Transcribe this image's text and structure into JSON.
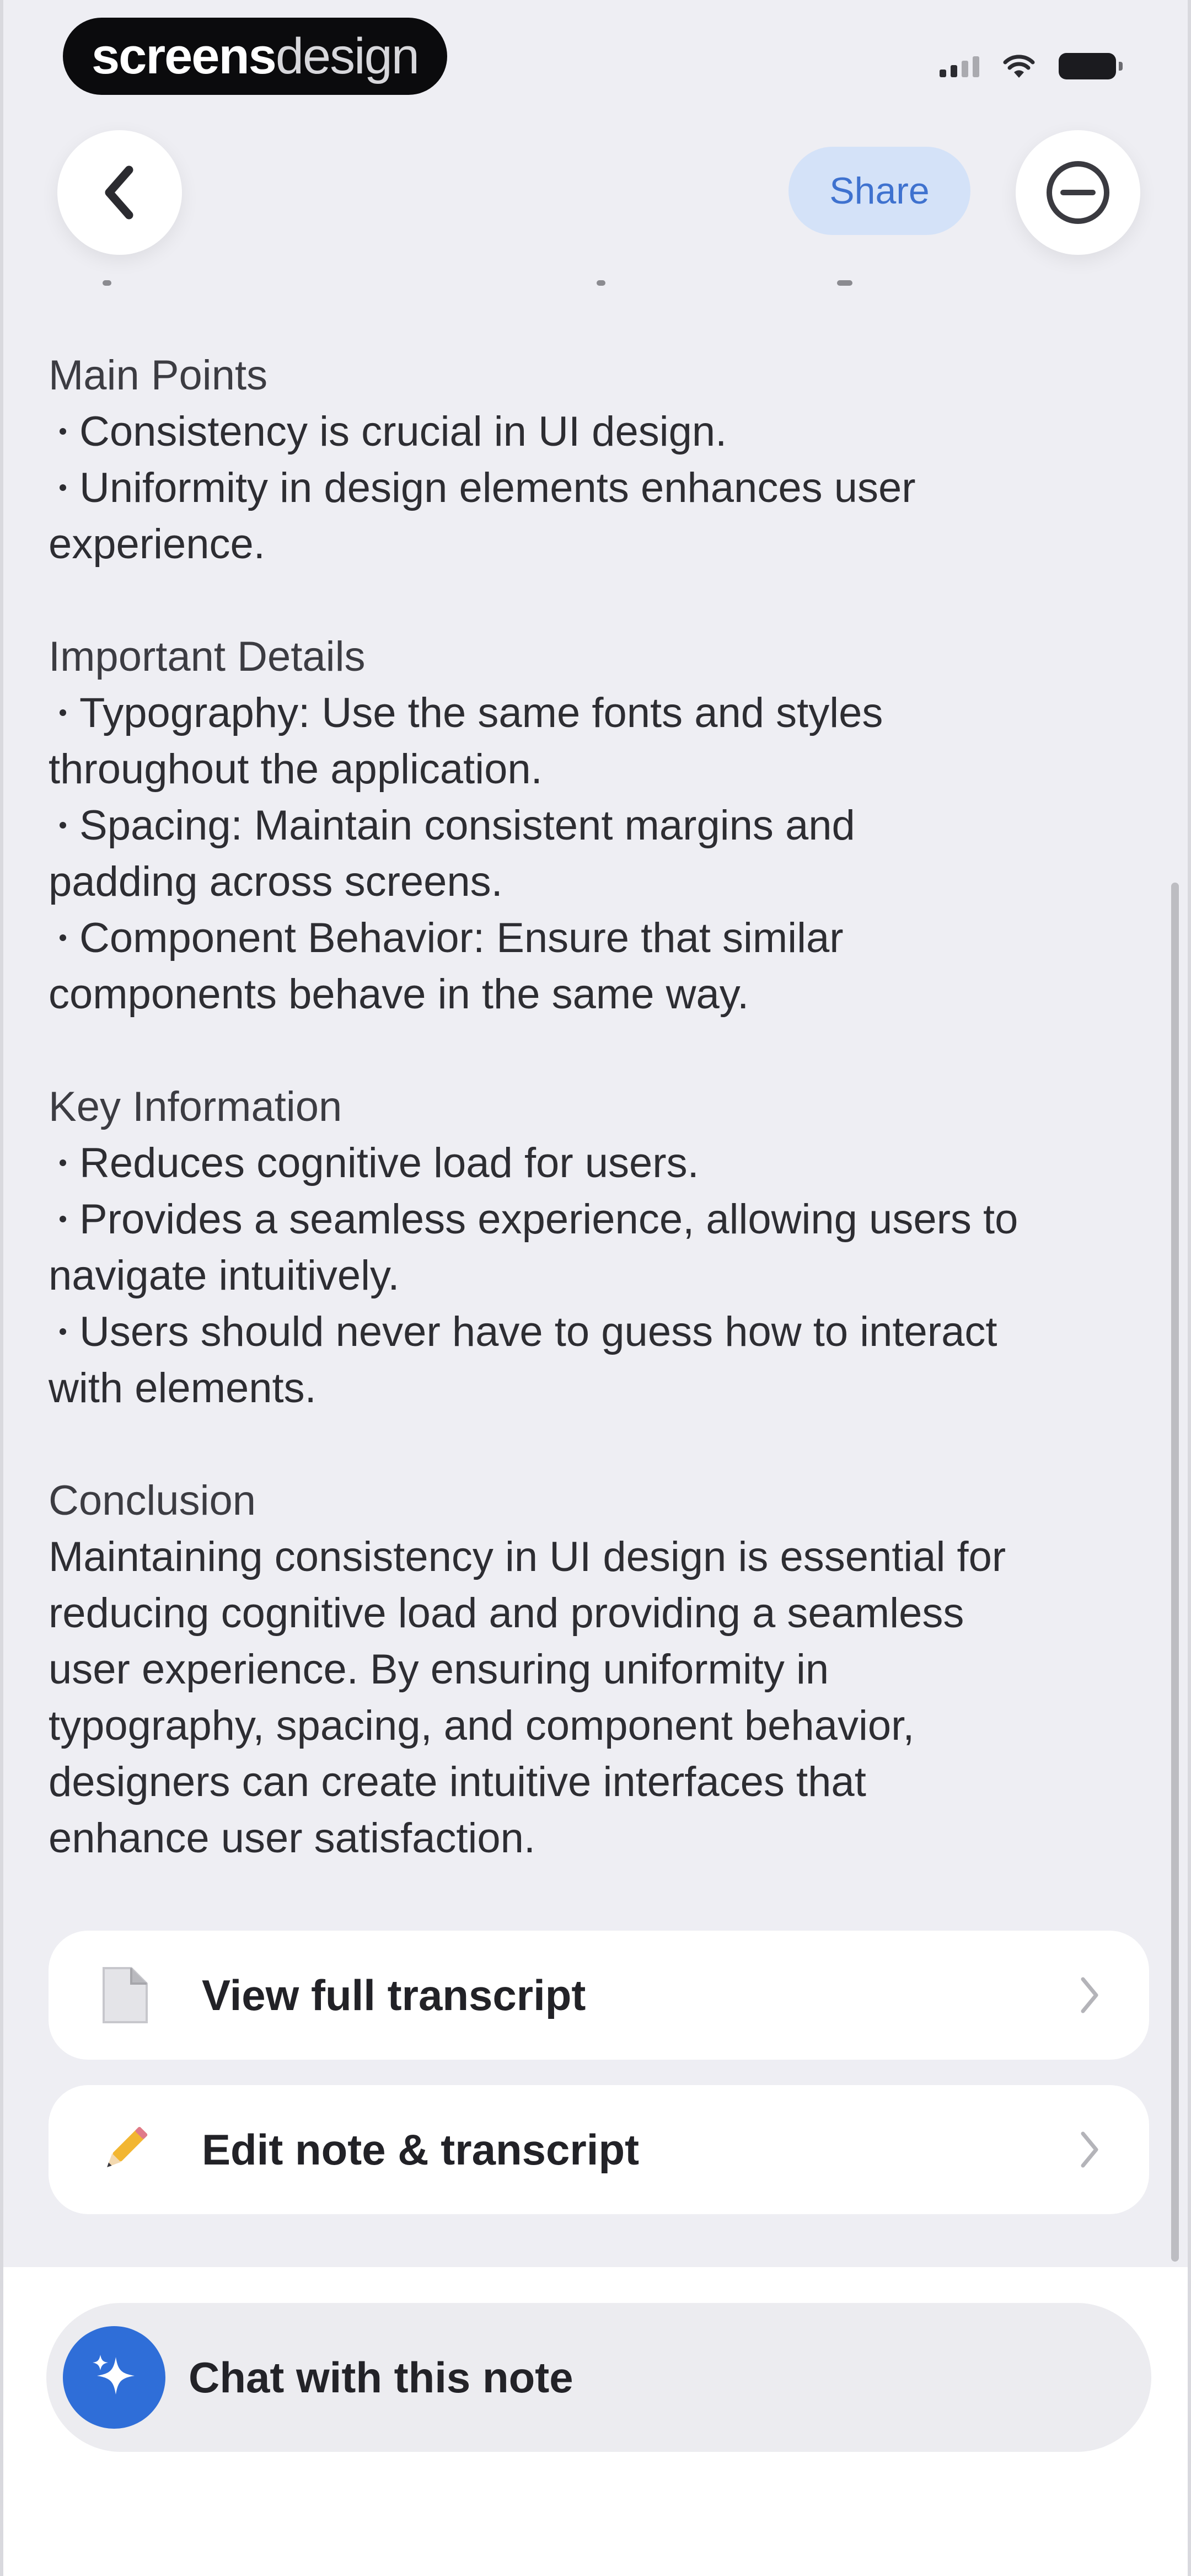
{
  "status_bar": {
    "brand_bold": "screens",
    "brand_light": "design"
  },
  "header": {
    "share_label": "Share",
    "back_icon": "chevron-left-icon",
    "more_icon": "minus-circle-icon"
  },
  "note": {
    "main_points": {
      "title": "Main Points",
      "bullets": [
        [
          "Consistency is crucial in UI design."
        ],
        [
          "Uniformity in design elements enhances user",
          "experience."
        ]
      ]
    },
    "important_details": {
      "title": "Important Details",
      "bullets": [
        [
          "Typography: Use the same fonts and styles",
          "throughout the application."
        ],
        [
          "Spacing: Maintain consistent margins and",
          "padding across screens."
        ],
        [
          "Component Behavior: Ensure that similar",
          "components behave in the same way."
        ]
      ]
    },
    "key_information": {
      "title": "Key Information",
      "bullets": [
        [
          "Reduces cognitive load for users."
        ],
        [
          "Provides a seamless experience, allowing users to",
          "navigate intuitively."
        ],
        [
          "Users should never have to guess how to interact",
          "with elements."
        ]
      ]
    },
    "conclusion": {
      "title": "Conclusion",
      "lines": [
        "Maintaining consistency in UI design is essential for",
        "reducing cognitive load and providing a seamless",
        "user experience. By ensuring uniformity in",
        "typography, spacing, and component behavior,",
        "designers can create intuitive interfaces that",
        "enhance user satisfaction."
      ]
    }
  },
  "actions": {
    "transcript": {
      "label": "View full transcript",
      "icon": "document-icon"
    },
    "edit": {
      "label": "Edit note & transcript",
      "icon": "pencil-icon"
    }
  },
  "chat": {
    "label": "Chat with this note",
    "icon": "sparkles-icon"
  },
  "colors": {
    "background": "#eeeef3",
    "accent_blue": "#2f6ed8",
    "share_bg": "#d4e2f8",
    "share_text": "#3f72cf"
  }
}
